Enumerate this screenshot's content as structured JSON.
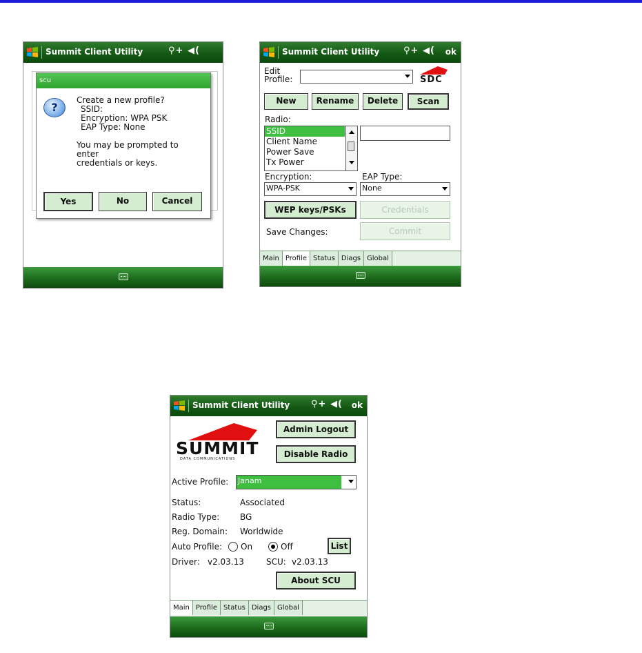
{
  "app": {
    "title": "Summit Client Utility",
    "status_icons": "⚲+ ◀(",
    "ok_label": "ok"
  },
  "tabs": [
    "Main",
    "Profile",
    "Status",
    "Diags",
    "Global"
  ],
  "screen1": {
    "dialog_title": "scu",
    "question_icon": "?",
    "message_lines": [
      "Create a new profile?",
      "SSID:",
      "Encryption: WPA PSK",
      "EAP Type: None",
      "",
      "You may be prompted to",
      "enter",
      "credentials or keys."
    ],
    "yes_label": "Yes",
    "no_label": "No",
    "cancel_label": "Cancel"
  },
  "screen2": {
    "edit_profile_label_line1": "Edit",
    "edit_profile_label_line2": "Profile:",
    "profile_value": "",
    "logo_text": "SDC",
    "new_label": "New",
    "rename_label": "Rename",
    "delete_label": "Delete",
    "scan_label": "Scan",
    "radio_label": "Radio:",
    "radio_items": [
      "SSID",
      "Client Name",
      "Power Save",
      "Tx Power"
    ],
    "radio_selected": "SSID",
    "value_field": "",
    "encryption_label": "Encryption:",
    "encryption_value": "WPA-PSK",
    "eap_label": "EAP Type:",
    "eap_value": "None",
    "wep_label": "WEP keys/PSKs",
    "credentials_label": "Credentials",
    "save_changes_label": "Save Changes:",
    "commit_label": "Commit"
  },
  "screen3": {
    "logo_main": "SUMMIT",
    "logo_sub": "DATA COMMUNICATIONS",
    "admin_logout_label": "Admin Logout",
    "disable_radio_label": "Disable Radio",
    "active_profile_label": "Active Profile:",
    "active_profile_value": "Janam",
    "status_label": "Status:",
    "status_value": "Associated",
    "radio_type_label": "Radio Type:",
    "radio_type_value": "BG",
    "reg_domain_label": "Reg. Domain:",
    "reg_domain_value": "Worldwide",
    "auto_profile_label": "Auto Profile:",
    "on_label": "On",
    "off_label": "Off",
    "auto_profile_selected": "Off",
    "list_label": "List",
    "driver_label": "Driver:",
    "driver_value": "v2.03.13",
    "scu_label": "SCU:",
    "scu_value": "v2.03.13",
    "about_label": "About SCU"
  },
  "colors": {
    "title_green": "#125612",
    "button_green": "#d4ecd0",
    "logo_red": "#e01010",
    "selected_green": "#3fbf3f",
    "page_top_rule": "#1a1ad8"
  }
}
